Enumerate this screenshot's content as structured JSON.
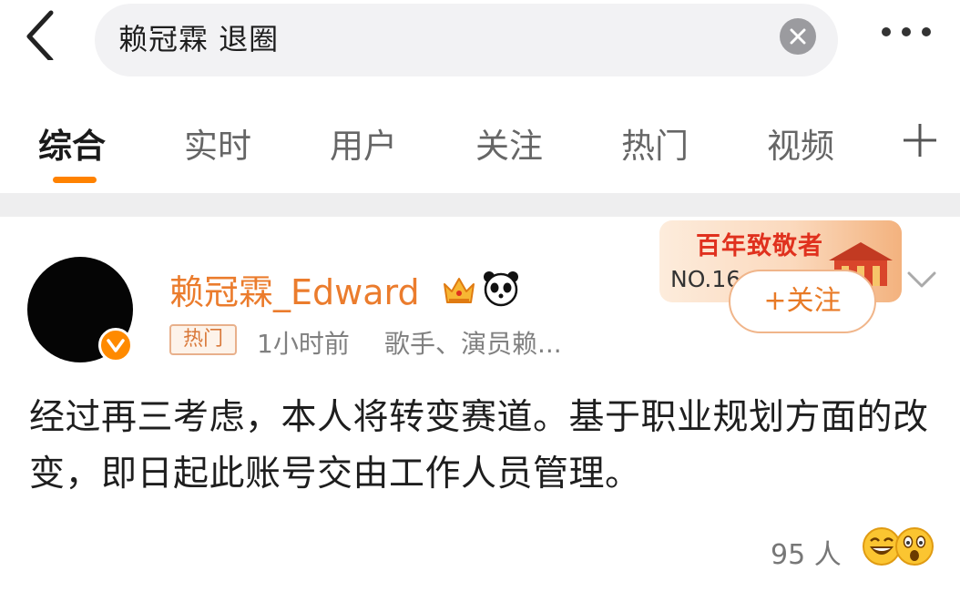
{
  "search": {
    "query": "赖冠霖 退圈"
  },
  "tabs": [
    {
      "label": "综合",
      "active": true
    },
    {
      "label": "实时"
    },
    {
      "label": "用户"
    },
    {
      "label": "关注"
    },
    {
      "label": "热门"
    },
    {
      "label": "视频"
    }
  ],
  "post": {
    "username": "赖冠霖_Edward",
    "hot_badge": "热门",
    "time": "1小时前",
    "description": "歌手、演员赖...",
    "follow_label": "+关注",
    "banner": {
      "title": "百年致敬者",
      "rank": "NO.16"
    },
    "content": "经过再三考虑，本人将转变赛道。基于职业规划方面的改变，即日起此账号交由工作人员管理。",
    "reactions": {
      "count_label": "95 人"
    }
  },
  "colors": {
    "accent": "#ff8200",
    "username": "#eb7c2d",
    "meta_text": "#808080"
  },
  "icons": [
    "back-arrow-icon",
    "clear-icon",
    "more-icon",
    "add-tab-icon",
    "verified-icon",
    "crown-icon",
    "panda-icon",
    "chevron-down-icon",
    "laugh-emoji-icon",
    "surprised-emoji-icon"
  ]
}
